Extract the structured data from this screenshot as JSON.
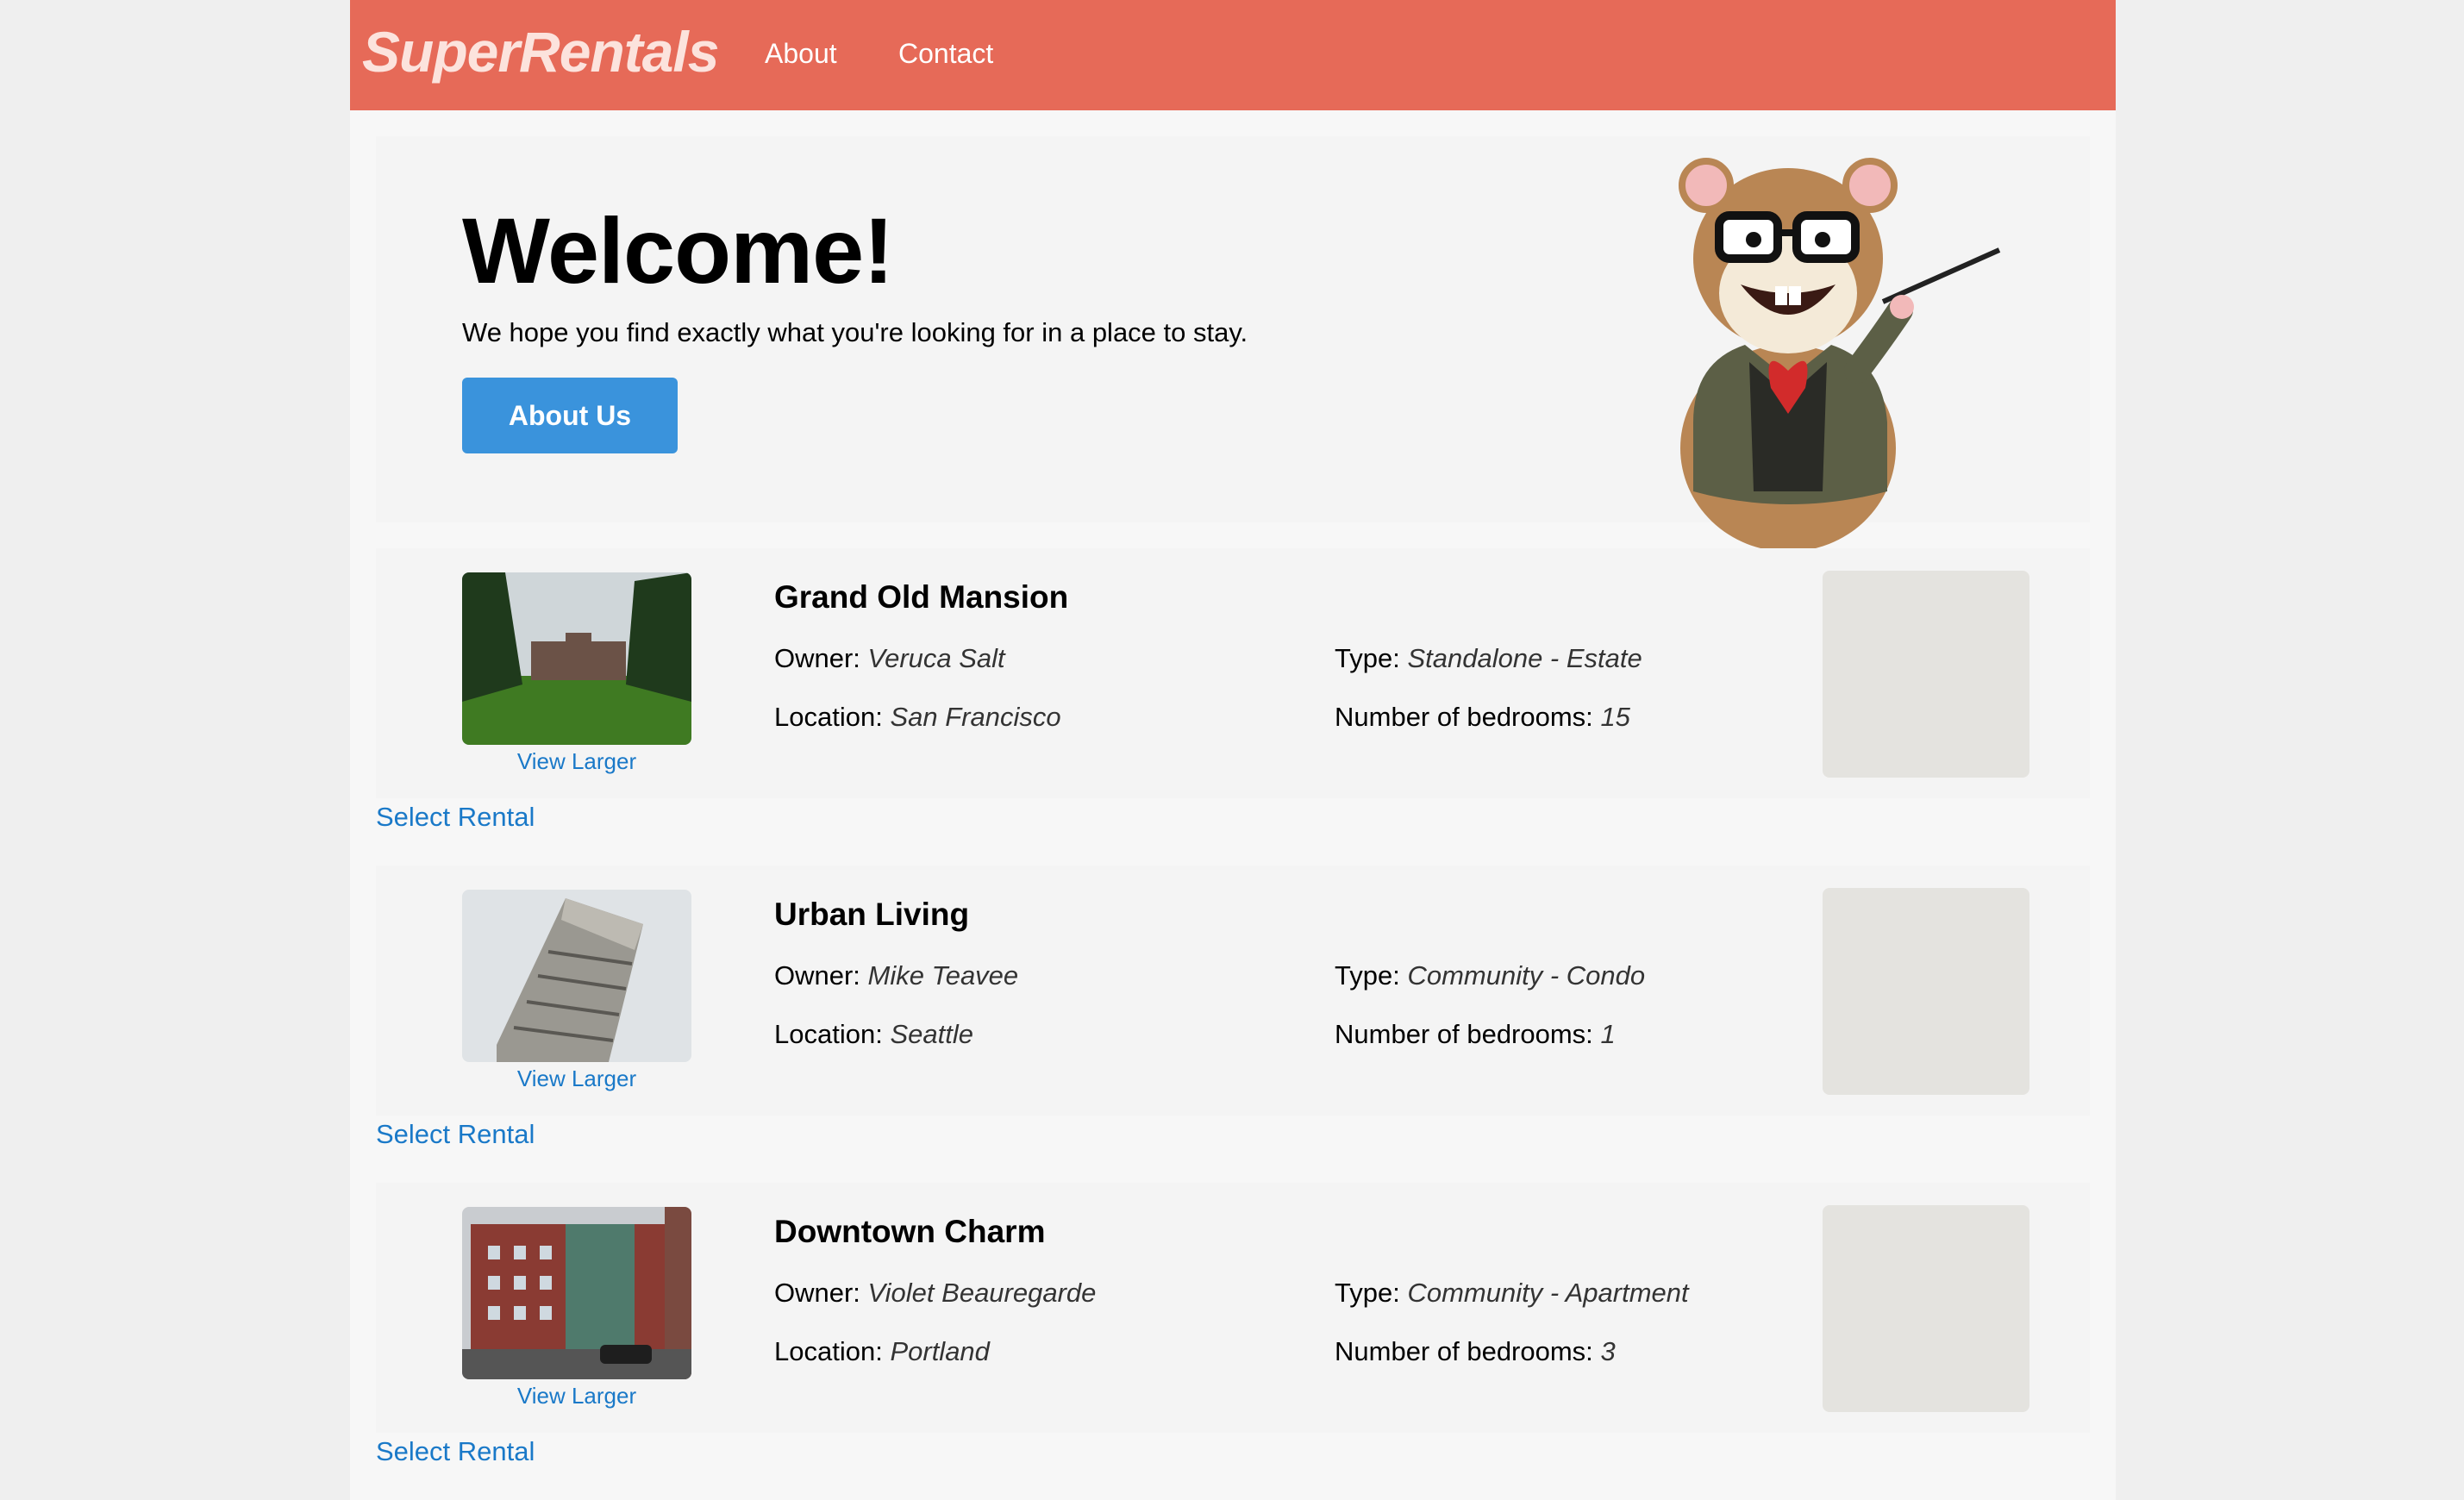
{
  "nav": {
    "brand": "SuperRentals",
    "links": [
      "About",
      "Contact"
    ]
  },
  "hero": {
    "heading": "Welcome!",
    "subtext": "We hope you find exactly what you're looking for in a place to stay.",
    "button_label": "About Us"
  },
  "labels": {
    "owner": "Owner:",
    "type": "Type:",
    "location": "Location:",
    "bedrooms": "Number of bedrooms:",
    "view_larger": "View Larger",
    "select_rental": "Select Rental"
  },
  "rentals": [
    {
      "title": "Grand Old Mansion",
      "owner": "Veruca Salt",
      "type": "Standalone - Estate",
      "location": "San Francisco",
      "bedrooms": "15"
    },
    {
      "title": "Urban Living",
      "owner": "Mike Teavee",
      "type": "Community - Condo",
      "location": "Seattle",
      "bedrooms": "1"
    },
    {
      "title": "Downtown Charm",
      "owner": "Violet Beauregarde",
      "type": "Community - Apartment",
      "location": "Portland",
      "bedrooms": "3"
    }
  ],
  "colors": {
    "header": "#e66a58",
    "button": "#3a93dc",
    "link": "#1a79c8"
  }
}
